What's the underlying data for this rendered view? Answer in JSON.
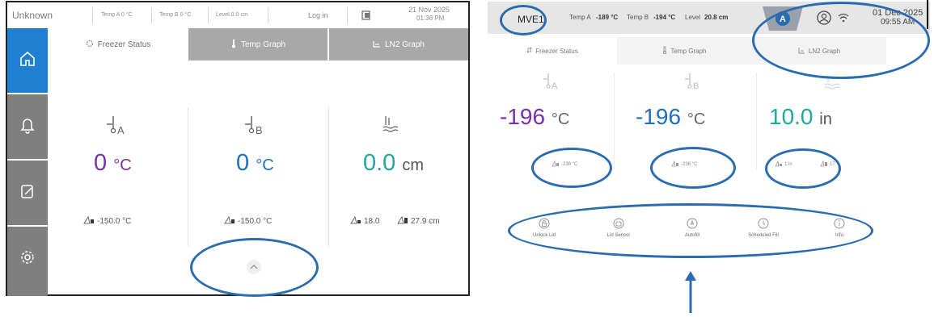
{
  "left_screen": {
    "top_bar": {
      "unit_name": "Unknown",
      "temp_a": "Temp A  0 °C",
      "temp_b": "Temp B  0 °C",
      "level": "Level  0.0 cm",
      "login": "Log in",
      "date": "21 Nov 2025",
      "time": "01:38 PM"
    },
    "sidebar": [
      {
        "icon": "home-icon",
        "active": true
      },
      {
        "icon": "bell-icon",
        "active": false
      },
      {
        "icon": "edit-note-icon",
        "active": false
      },
      {
        "icon": "gear-icon",
        "active": false
      }
    ],
    "tabs": [
      {
        "label": "Freezer Status",
        "icon": "gear-icon",
        "active": true
      },
      {
        "label": "Temp Graph",
        "icon": "thermometer-icon",
        "active": false
      },
      {
        "label": "LN2 Graph",
        "icon": "level-icon",
        "active": false
      }
    ],
    "sensors": [
      {
        "sub": "A",
        "value": "0",
        "unit": "°C",
        "color": "#7b2fa8",
        "alarm": "-150.0 °C"
      },
      {
        "sub": "B",
        "value": "0",
        "unit": "°C",
        "color": "#1f6fbf",
        "alarm": "-150.0 °C"
      },
      {
        "sub": "",
        "value": "0.0",
        "unit": "cm",
        "color": "#22a7a0",
        "alarm_low": "18.0",
        "alarm_high": "27.9 cm"
      }
    ],
    "expand_button": "chevron-up-icon"
  },
  "right_screen": {
    "top_bar": {
      "unit_name": "MVE1",
      "temp_a_label": "Temp A",
      "temp_a_value": "-189 °C",
      "temp_b_label": "Temp B",
      "temp_b_value": "-194 °C",
      "level_label": "Level",
      "level_value": "20.8 cm",
      "user_badge": "A",
      "date": "01 Dec 2025",
      "time": "09:55 AM"
    },
    "tabs": [
      {
        "label": "Freezer Status",
        "icon": "sort-icon"
      },
      {
        "label": "Temp Graph",
        "icon": "thermometer-icon"
      },
      {
        "label": "LN2 Graph",
        "icon": "level-icon"
      }
    ],
    "sensors": [
      {
        "sub": "A",
        "value": "-196",
        "unit": "°C",
        "color": "#7b2fa8",
        "alarm": "-238 °C"
      },
      {
        "sub": "B",
        "value": "-196",
        "unit": "°C",
        "color": "#1f6fbf",
        "alarm": "-238 °C"
      },
      {
        "sub": "",
        "value": "10.0",
        "unit": "in",
        "color": "#22a7a0",
        "alarm_low": "1 in",
        "alarm_high": "17"
      }
    ],
    "actions": [
      {
        "label": "Unlock Lid",
        "icon": "lock-icon"
      },
      {
        "label": "Lid Sensor",
        "icon": "sensor-icon"
      },
      {
        "label": "Autofill",
        "icon": "autofill-icon"
      },
      {
        "label": "Scheduled Fill",
        "icon": "schedule-icon"
      },
      {
        "label": "Info",
        "icon": "info-icon"
      }
    ]
  },
  "annotation_color": "#2b6cb0"
}
